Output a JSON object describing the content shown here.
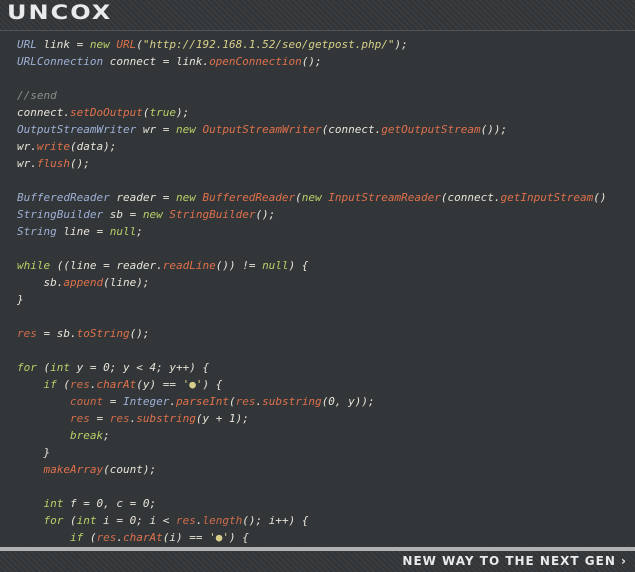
{
  "header": {
    "logo_text": "UNCOX"
  },
  "footer": {
    "tagline": "NEW WAY TO THE NEXT GEN ›"
  },
  "colors": {
    "keyword": "#b7d168",
    "type": "#9fb0d7",
    "method": "#e0704c",
    "string": "#d8d08a",
    "comment": "#8a8e8a",
    "plain": "#e8e4d8"
  },
  "code": {
    "language": "java",
    "lines": [
      [
        [
          "type",
          "URL"
        ],
        [
          "plain",
          " link = "
        ],
        [
          "kw",
          "new"
        ],
        [
          "plain",
          " "
        ],
        [
          "method",
          "URL"
        ],
        [
          "plain",
          "("
        ],
        [
          "str",
          "\"http://192.168.1.52/seo/getpost.php/\""
        ],
        [
          "plain",
          ");"
        ]
      ],
      [
        [
          "type",
          "URLConnection"
        ],
        [
          "plain",
          " connect = link."
        ],
        [
          "method",
          "openConnection"
        ],
        [
          "plain",
          "();"
        ]
      ],
      [],
      [
        [
          "comment",
          "//send"
        ]
      ],
      [
        [
          "plain",
          "connect."
        ],
        [
          "method",
          "setDoOutput"
        ],
        [
          "plain",
          "("
        ],
        [
          "kw",
          "true"
        ],
        [
          "plain",
          ");"
        ]
      ],
      [
        [
          "type",
          "OutputStreamWriter"
        ],
        [
          "plain",
          " wr = "
        ],
        [
          "kw",
          "new"
        ],
        [
          "plain",
          " "
        ],
        [
          "method",
          "OutputStreamWriter"
        ],
        [
          "plain",
          "(connect."
        ],
        [
          "method",
          "getOutputStream"
        ],
        [
          "plain",
          "());"
        ]
      ],
      [
        [
          "plain",
          "wr."
        ],
        [
          "method",
          "write"
        ],
        [
          "plain",
          "(data);"
        ]
      ],
      [
        [
          "plain",
          "wr."
        ],
        [
          "method",
          "flush"
        ],
        [
          "plain",
          "();"
        ]
      ],
      [],
      [
        [
          "type",
          "BufferedReader"
        ],
        [
          "plain",
          " reader = "
        ],
        [
          "kw",
          "new"
        ],
        [
          "plain",
          " "
        ],
        [
          "method",
          "BufferedReader"
        ],
        [
          "plain",
          "("
        ],
        [
          "kw",
          "new"
        ],
        [
          "plain",
          " "
        ],
        [
          "method",
          "InputStreamReader"
        ],
        [
          "plain",
          "(connect."
        ],
        [
          "method",
          "getInputStream"
        ],
        [
          "plain",
          "()"
        ]
      ],
      [
        [
          "type",
          "StringBuilder"
        ],
        [
          "plain",
          " sb = "
        ],
        [
          "kw",
          "new"
        ],
        [
          "plain",
          " "
        ],
        [
          "method",
          "StringBuilder"
        ],
        [
          "plain",
          "();"
        ]
      ],
      [
        [
          "type",
          "String"
        ],
        [
          "plain",
          " line = "
        ],
        [
          "kw",
          "null"
        ],
        [
          "plain",
          ";"
        ]
      ],
      [],
      [
        [
          "kw",
          "while"
        ],
        [
          "plain",
          " ((line = reader."
        ],
        [
          "method",
          "readLine"
        ],
        [
          "plain",
          "()) != "
        ],
        [
          "kw",
          "null"
        ],
        [
          "plain",
          ") {"
        ]
      ],
      [
        [
          "plain",
          "    sb."
        ],
        [
          "method",
          "append"
        ],
        [
          "plain",
          "(line);"
        ]
      ],
      [
        [
          "plain",
          "}"
        ]
      ],
      [],
      [
        [
          "var",
          "res"
        ],
        [
          "plain",
          " = sb."
        ],
        [
          "method",
          "toString"
        ],
        [
          "plain",
          "();"
        ]
      ],
      [],
      [
        [
          "kw",
          "for"
        ],
        [
          "plain",
          " ("
        ],
        [
          "kw",
          "int"
        ],
        [
          "plain",
          " y = 0; y < 4; y++) {"
        ]
      ],
      [
        [
          "plain",
          "    "
        ],
        [
          "kw",
          "if"
        ],
        [
          "plain",
          " ("
        ],
        [
          "var",
          "res"
        ],
        [
          "plain",
          "."
        ],
        [
          "method",
          "charAt"
        ],
        [
          "plain",
          "(y) == "
        ],
        [
          "str",
          "'●'"
        ],
        [
          "plain",
          ") {"
        ]
      ],
      [
        [
          "plain",
          "        "
        ],
        [
          "var",
          "count"
        ],
        [
          "plain",
          " = "
        ],
        [
          "type",
          "Integer"
        ],
        [
          "plain",
          "."
        ],
        [
          "method",
          "parseInt"
        ],
        [
          "plain",
          "("
        ],
        [
          "var",
          "res"
        ],
        [
          "plain",
          "."
        ],
        [
          "method",
          "substring"
        ],
        [
          "plain",
          "(0, y));"
        ]
      ],
      [
        [
          "plain",
          "        "
        ],
        [
          "var",
          "res"
        ],
        [
          "plain",
          " = "
        ],
        [
          "var",
          "res"
        ],
        [
          "plain",
          "."
        ],
        [
          "method",
          "substring"
        ],
        [
          "plain",
          "(y + 1);"
        ]
      ],
      [
        [
          "plain",
          "        "
        ],
        [
          "kw",
          "break"
        ],
        [
          "plain",
          ";"
        ]
      ],
      [
        [
          "plain",
          "    }"
        ]
      ],
      [
        [
          "plain",
          "    "
        ],
        [
          "method",
          "makeArray"
        ],
        [
          "plain",
          "(count);"
        ]
      ],
      [],
      [
        [
          "plain",
          "    "
        ],
        [
          "kw",
          "int"
        ],
        [
          "plain",
          " f = 0, c = 0;"
        ]
      ],
      [
        [
          "plain",
          "    "
        ],
        [
          "kw",
          "for"
        ],
        [
          "plain",
          " ("
        ],
        [
          "kw",
          "int"
        ],
        [
          "plain",
          " i = 0; i < "
        ],
        [
          "var",
          "res"
        ],
        [
          "plain",
          "."
        ],
        [
          "var",
          "length"
        ],
        [
          "plain",
          "(); i++) {"
        ]
      ],
      [
        [
          "plain",
          "        "
        ],
        [
          "kw",
          "if"
        ],
        [
          "plain",
          " ("
        ],
        [
          "var",
          "res"
        ],
        [
          "plain",
          "."
        ],
        [
          "method",
          "charAt"
        ],
        [
          "plain",
          "(i) == "
        ],
        [
          "str",
          "'●'"
        ],
        [
          "plain",
          ") {"
        ]
      ]
    ]
  }
}
